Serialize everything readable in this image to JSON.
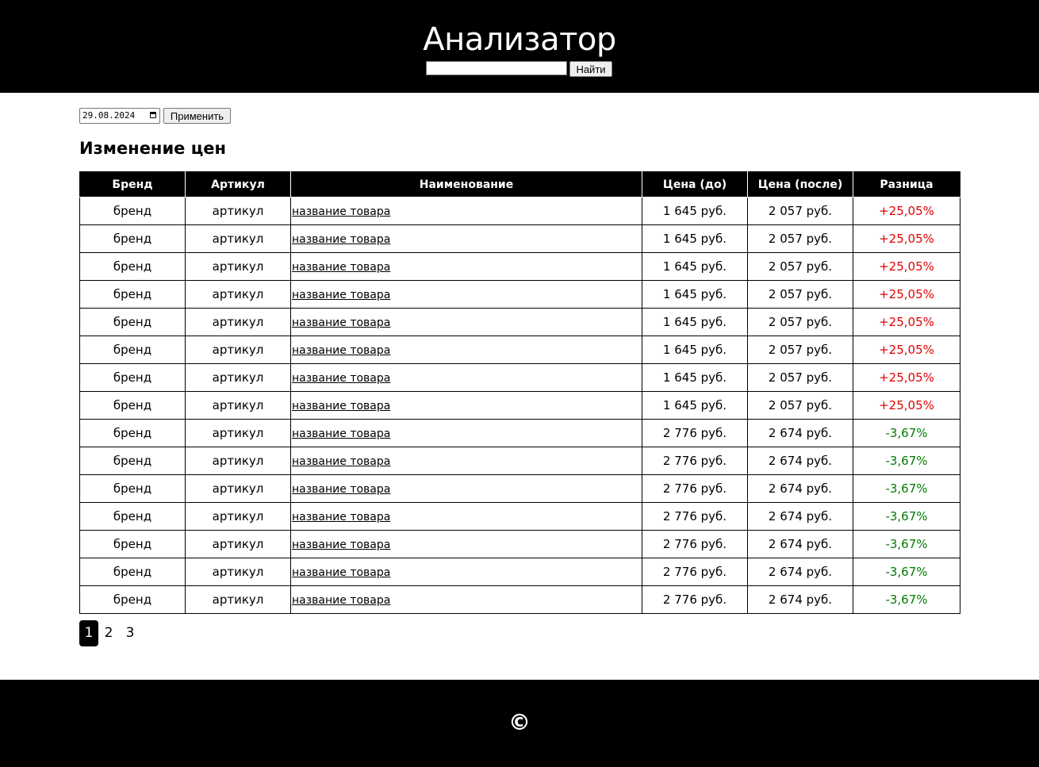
{
  "header": {
    "title": "Анализатор",
    "search_value": "",
    "search_button": "Найти"
  },
  "filter": {
    "date_value": "29.08.2024",
    "apply_button": "Применить"
  },
  "section_title": "Изменение цен",
  "table": {
    "columns": [
      "Бренд",
      "Артикул",
      "Наименование",
      "Цена (до)",
      "Цена (после)",
      "Разница"
    ],
    "rows": [
      {
        "brand": "бренд",
        "sku": "артикул",
        "name": "название товара",
        "price_before": "1 645 руб.",
        "price_after": "2 057 руб.",
        "diff": "+25,05%",
        "direction": "up"
      },
      {
        "brand": "бренд",
        "sku": "артикул",
        "name": "название товара",
        "price_before": "1 645 руб.",
        "price_after": "2 057 руб.",
        "diff": "+25,05%",
        "direction": "up"
      },
      {
        "brand": "бренд",
        "sku": "артикул",
        "name": "название товара",
        "price_before": "1 645 руб.",
        "price_after": "2 057 руб.",
        "diff": "+25,05%",
        "direction": "up"
      },
      {
        "brand": "бренд",
        "sku": "артикул",
        "name": "название товара",
        "price_before": "1 645 руб.",
        "price_after": "2 057 руб.",
        "diff": "+25,05%",
        "direction": "up"
      },
      {
        "brand": "бренд",
        "sku": "артикул",
        "name": "название товара",
        "price_before": "1 645 руб.",
        "price_after": "2 057 руб.",
        "diff": "+25,05%",
        "direction": "up"
      },
      {
        "brand": "бренд",
        "sku": "артикул",
        "name": "название товара",
        "price_before": "1 645 руб.",
        "price_after": "2 057 руб.",
        "diff": "+25,05%",
        "direction": "up"
      },
      {
        "brand": "бренд",
        "sku": "артикул",
        "name": "название товара",
        "price_before": "1 645 руб.",
        "price_after": "2 057 руб.",
        "diff": "+25,05%",
        "direction": "up"
      },
      {
        "brand": "бренд",
        "sku": "артикул",
        "name": "название товара",
        "price_before": "1 645 руб.",
        "price_after": "2 057 руб.",
        "diff": "+25,05%",
        "direction": "up"
      },
      {
        "brand": "бренд",
        "sku": "артикул",
        "name": "название товара",
        "price_before": "2 776 руб.",
        "price_after": "2 674 руб.",
        "diff": "-3,67%",
        "direction": "down"
      },
      {
        "brand": "бренд",
        "sku": "артикул",
        "name": "название товара",
        "price_before": "2 776 руб.",
        "price_after": "2 674 руб.",
        "diff": "-3,67%",
        "direction": "down"
      },
      {
        "brand": "бренд",
        "sku": "артикул",
        "name": "название товара",
        "price_before": "2 776 руб.",
        "price_after": "2 674 руб.",
        "diff": "-3,67%",
        "direction": "down"
      },
      {
        "brand": "бренд",
        "sku": "артикул",
        "name": "название товара",
        "price_before": "2 776 руб.",
        "price_after": "2 674 руб.",
        "diff": "-3,67%",
        "direction": "down"
      },
      {
        "brand": "бренд",
        "sku": "артикул",
        "name": "название товара",
        "price_before": "2 776 руб.",
        "price_after": "2 674 руб.",
        "diff": "-3,67%",
        "direction": "down"
      },
      {
        "brand": "бренд",
        "sku": "артикул",
        "name": "название товара",
        "price_before": "2 776 руб.",
        "price_after": "2 674 руб.",
        "diff": "-3,67%",
        "direction": "down"
      },
      {
        "brand": "бренд",
        "sku": "артикул",
        "name": "название товара",
        "price_before": "2 776 руб.",
        "price_after": "2 674 руб.",
        "diff": "-3,67%",
        "direction": "down"
      }
    ]
  },
  "pagination": {
    "pages": [
      "1",
      "2",
      "3"
    ],
    "current": "1"
  },
  "footer": {
    "copyright": "©"
  },
  "colors": {
    "header_bg": "#000000",
    "increase": "#e00000",
    "decrease": "#007a00"
  }
}
